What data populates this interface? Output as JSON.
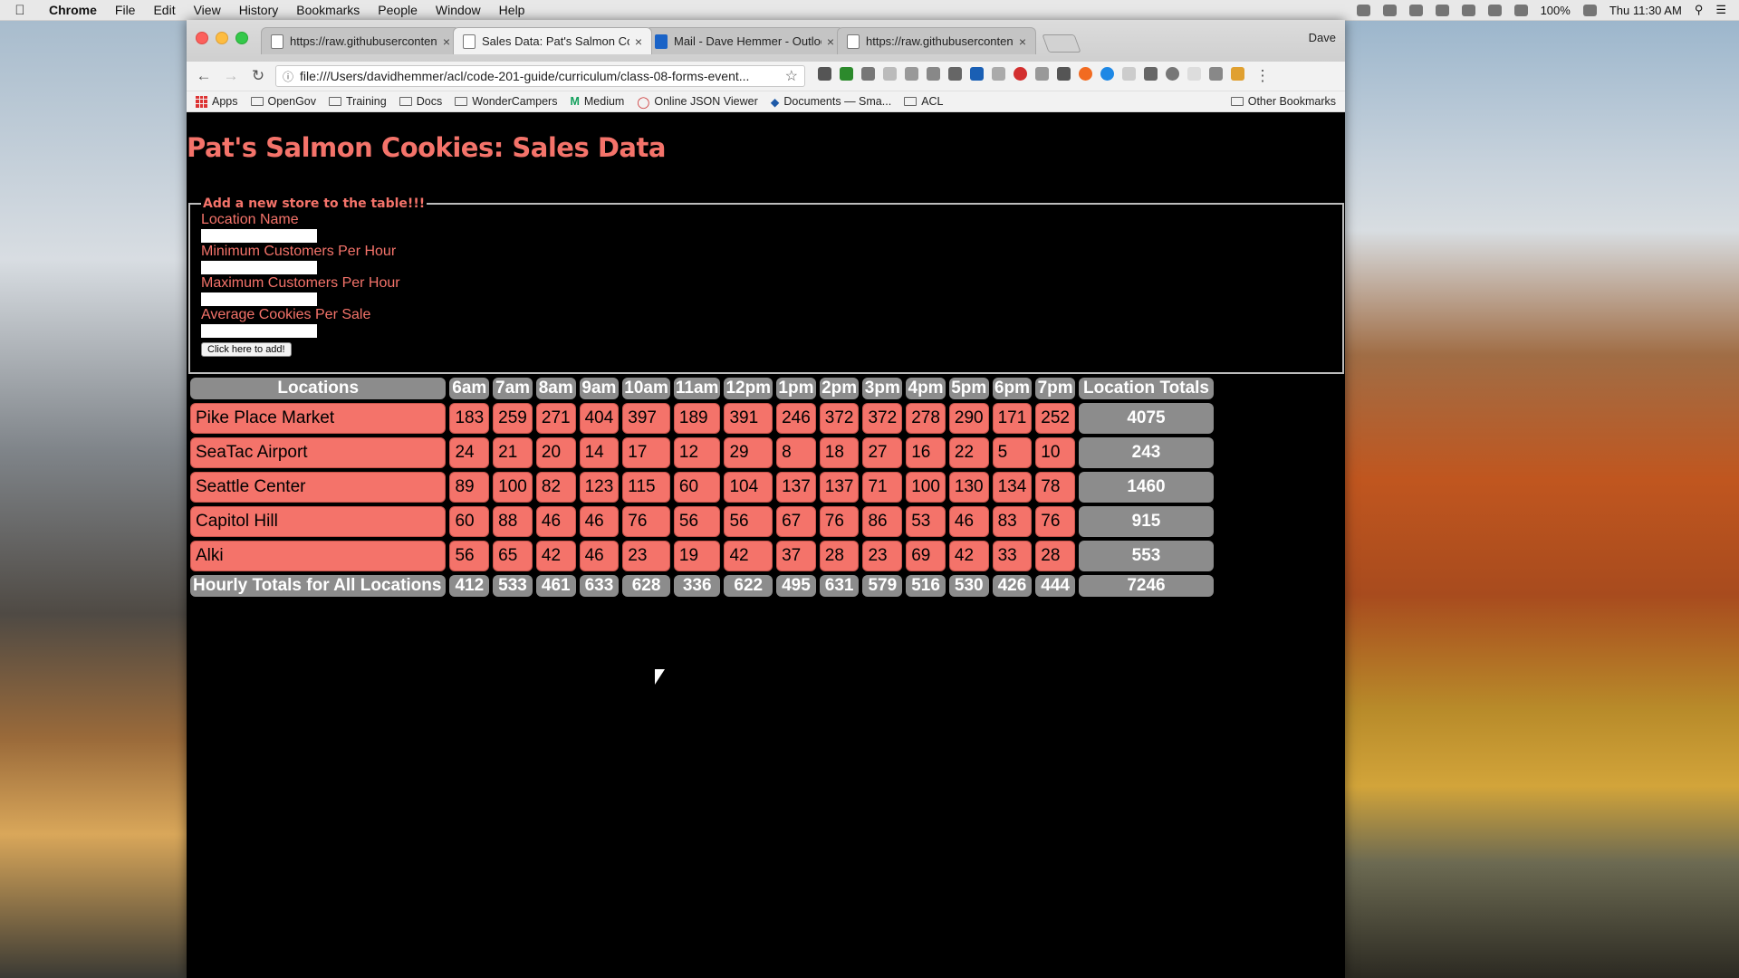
{
  "menubar": {
    "app": "Chrome",
    "menus": [
      "File",
      "Edit",
      "View",
      "History",
      "Bookmarks",
      "People",
      "Window",
      "Help"
    ],
    "battery": "100%",
    "clock": "Thu 11:30 AM"
  },
  "browser": {
    "user": "Dave",
    "tabs": [
      {
        "title": "https://raw.githubusercontent.",
        "close": "×"
      },
      {
        "title": "Sales Data: Pat's Salmon Cook",
        "close": "×"
      },
      {
        "title": "Mail - Dave Hemmer - Outlook",
        "close": "×"
      },
      {
        "title": "https://raw.githubusercontent.",
        "close": "×"
      }
    ],
    "url": "file:///Users/davidhemmer/acl/code-201-guide/curriculum/class-08-forms-event...",
    "bookmarks": [
      "Apps",
      "OpenGov",
      "Training",
      "Docs",
      "WonderCampers",
      "Medium",
      "Online JSON Viewer",
      "Documents — Sma...",
      "ACL"
    ],
    "other_bookmarks": "Other Bookmarks"
  },
  "page": {
    "title": "Pat's Salmon Cookies: Sales Data",
    "form": {
      "legend": "Add a new store to the table!!!",
      "fields": [
        "Location Name",
        "Minimum Customers Per Hour",
        "Maximum Customers Per Hour",
        "Average Cookies Per Sale"
      ],
      "submit_label": "Click here to add!"
    },
    "table": {
      "headers": [
        "Locations",
        "6am",
        "7am",
        "8am",
        "9am",
        "10am",
        "11am",
        "12pm",
        "1pm",
        "2pm",
        "3pm",
        "4pm",
        "5pm",
        "6pm",
        "7pm",
        "Location Totals"
      ],
      "rows": [
        {
          "location": "Pike Place Market",
          "hours": [
            183,
            259,
            271,
            404,
            397,
            189,
            391,
            246,
            372,
            372,
            278,
            290,
            171,
            252
          ],
          "total": 4075
        },
        {
          "location": "SeaTac Airport",
          "hours": [
            24,
            21,
            20,
            14,
            17,
            12,
            29,
            8,
            18,
            27,
            16,
            22,
            5,
            10
          ],
          "total": 243
        },
        {
          "location": "Seattle Center",
          "hours": [
            89,
            100,
            82,
            123,
            115,
            60,
            104,
            137,
            137,
            71,
            100,
            130,
            134,
            78
          ],
          "total": 1460
        },
        {
          "location": "Capitol Hill",
          "hours": [
            60,
            88,
            46,
            46,
            76,
            56,
            56,
            67,
            76,
            86,
            53,
            46,
            83,
            76
          ],
          "total": 915
        },
        {
          "location": "Alki",
          "hours": [
            56,
            65,
            42,
            46,
            23,
            19,
            42,
            37,
            28,
            23,
            69,
            42,
            33,
            28
          ],
          "total": 553
        }
      ],
      "footer": {
        "label": "Hourly Totals for All Locations",
        "hours": [
          412,
          533,
          461,
          633,
          628,
          336,
          622,
          495,
          631,
          579,
          516,
          530,
          426,
          444
        ],
        "total": 7246
      }
    }
  }
}
